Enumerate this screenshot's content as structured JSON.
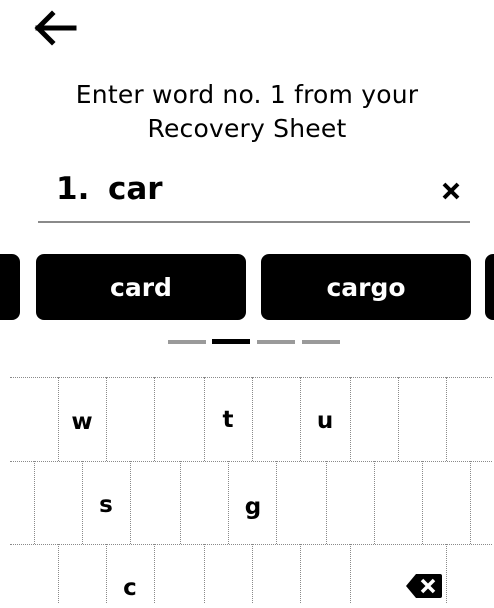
{
  "header": {
    "back_icon": "arrow-left-icon"
  },
  "prompt": {
    "line1": "Enter word no. 1 from your",
    "line2": "Recovery Sheet"
  },
  "word_input": {
    "number": "1.",
    "value": "car",
    "clear_icon": "close-icon"
  },
  "suggestions": [
    "card",
    "cargo"
  ],
  "pager": {
    "pages": 4,
    "active_page": 2
  },
  "keyboard": {
    "row1": [
      "w",
      "t",
      "u"
    ],
    "row2": [
      "s",
      "g"
    ],
    "row3": [
      "c"
    ],
    "backspace_icon": "backspace-icon"
  },
  "colors": {
    "background": "#ffffff",
    "button": "#000000",
    "button_text": "#ffffff",
    "divider": "#8a8a8a"
  }
}
